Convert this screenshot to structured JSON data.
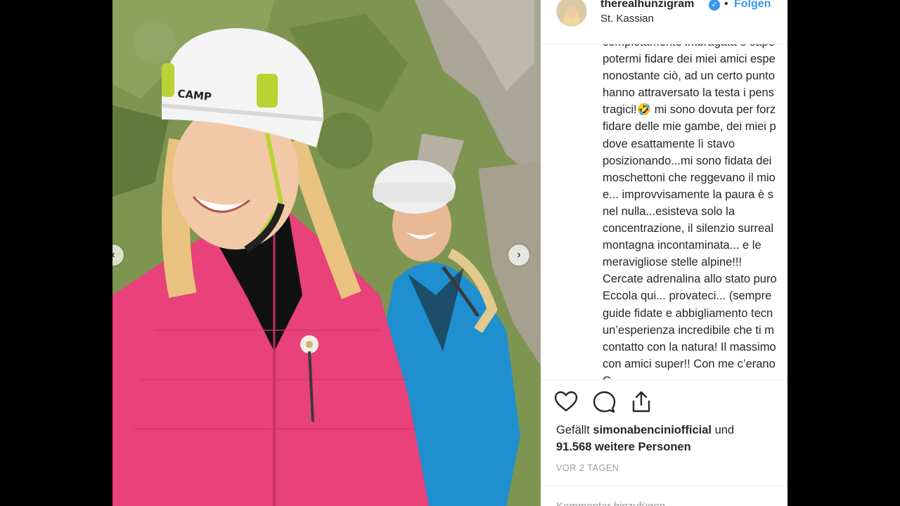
{
  "post": {
    "username": "therealhunzigram",
    "separator": "•",
    "follow_label": "Folgen",
    "location": "St. Kassian",
    "caption_lines": [
      "completamente imbragata e sape",
      "potermi fidare dei miei amici espe",
      "nonostante ciò, ad un certo punto",
      "hanno attraversato la testa i pens",
      "tragici!🤣 mi sono dovuta per forz",
      "fidare delle mie gambe, dei miei p",
      "dove esattamente lì stavo",
      "posizionando...mi sono fidata dei",
      "moschettoni che reggevano il mio",
      "e... improvvisamente la paura è s",
      "nel nulla...esisteva solo la",
      "concentrazione, il silenzio surreal",
      "montagna incontaminata... e le",
      "meravigliose stelle alpine!!!",
      "Cercate adrenalina allo stato puro",
      "Eccola qui... provateci... (sempre",
      "guide fidate e abbigliamento tecn",
      "un’esperienza incredibile che ti m",
      "contatto con la natura! Il massimo",
      "con amici super!! Con me c’erano",
      "C"
    ],
    "likes": {
      "prefix": "Gefällt",
      "liker": "simonabenciniofficial",
      "conjunction": "und",
      "count_text": "91.568 weitere Personen"
    },
    "timestamp": "VOR 2 TAGEN",
    "comment_placeholder": "Kommentar hinzufügen ..."
  },
  "icons": {
    "like": "heart-icon",
    "comment": "comment-bubble-icon",
    "share": "share-icon",
    "verified": "verified-badge-icon",
    "prev": "chevron-left-icon",
    "next": "chevron-right-icon"
  },
  "colors": {
    "accent": "#3897f0",
    "text": "#262626",
    "muted": "#999999"
  }
}
